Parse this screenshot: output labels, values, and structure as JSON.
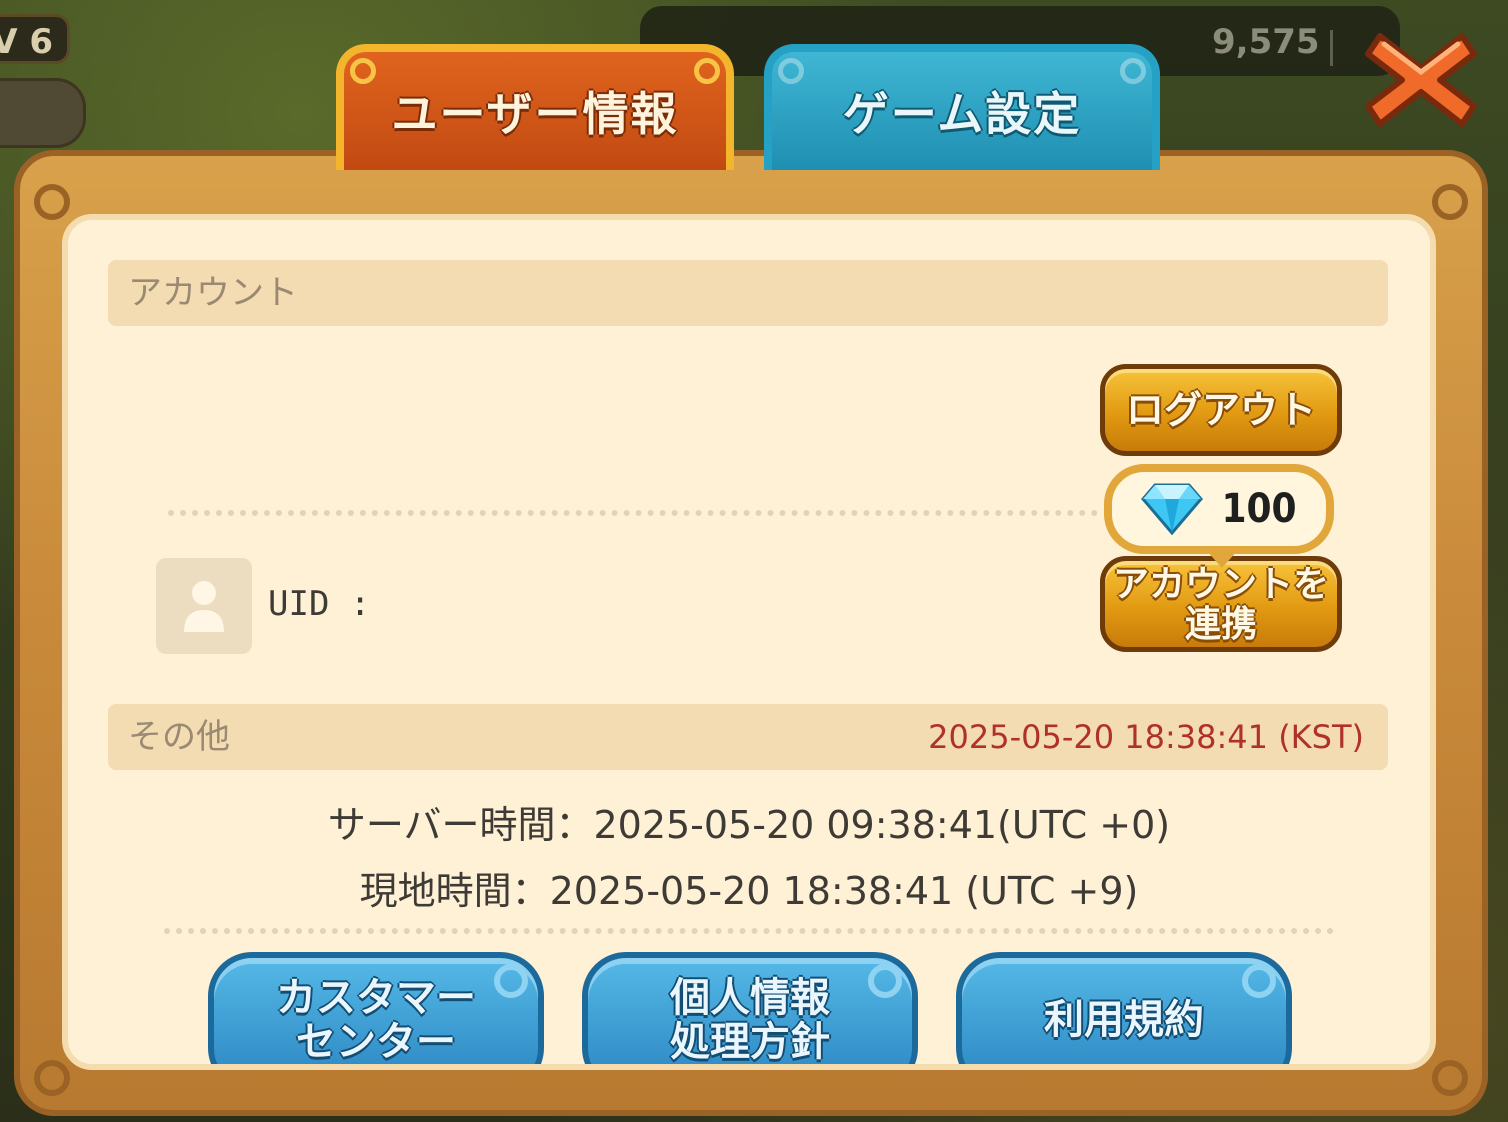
{
  "hud": {
    "level": "V 6",
    "coins": "9,575"
  },
  "tabs": [
    {
      "label": "ユーザー情報"
    },
    {
      "label": "ゲーム設定"
    }
  ],
  "account": {
    "header": "アカウント",
    "uid_label": "UID :",
    "logout_label": "ログアウト",
    "reward_value": "100",
    "reward_icon": "diamond-icon",
    "link_label_line1": "アカウントを",
    "link_label_line2": "連携"
  },
  "other": {
    "header": "その他",
    "kst_time": "2025-05-20 18:38:41 (KST)",
    "server_time": "サーバー時間：2025-05-20 09:38:41(UTC +0)",
    "local_time": "現地時間：2025-05-20 18:38:41 (UTC +9)"
  },
  "bottom_buttons": [
    {
      "line1": "カスタマー",
      "line2": "センター"
    },
    {
      "line1": "個人情報",
      "line2": "処理方針"
    },
    {
      "line1": "利用規約",
      "line2": ""
    }
  ],
  "colors": {
    "tab_active": "#d2581a",
    "tab_inactive": "#2ba3c7",
    "panel_bg": "#fff1d6",
    "kst_text": "#b0302a",
    "gold_button": "#e19a12",
    "blue_button": "#2b86c2"
  }
}
